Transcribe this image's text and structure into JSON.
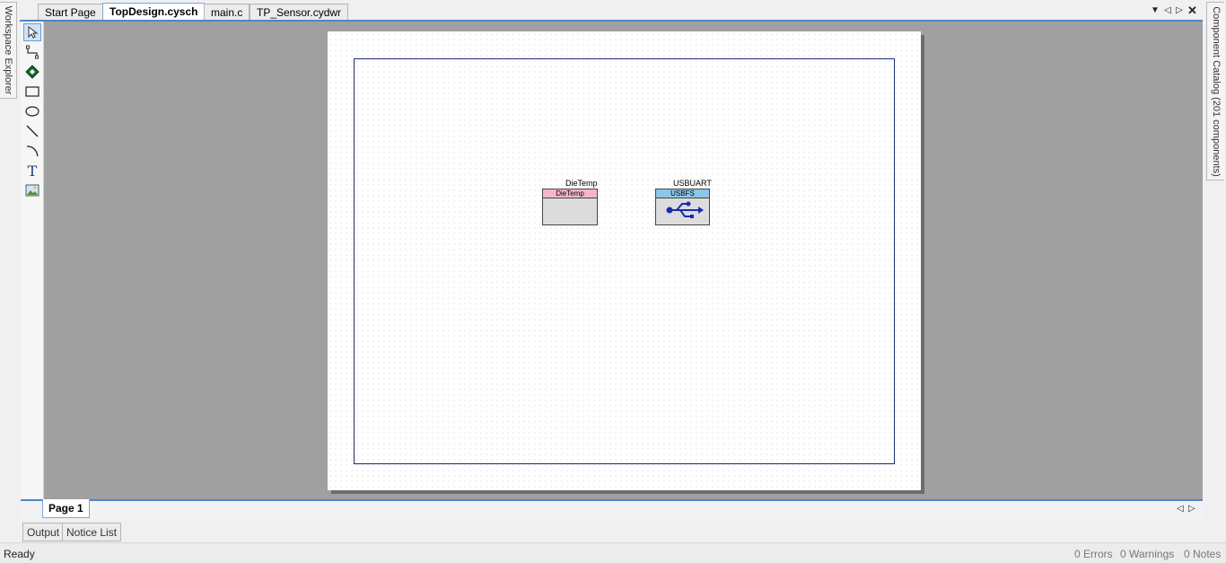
{
  "side_panels": {
    "left_label": "Workspace Explorer",
    "right_label": "Component Catalog (201 components)"
  },
  "doc_tabs": [
    {
      "label": "Start Page"
    },
    {
      "label": "TopDesign.cysch"
    },
    {
      "label": "main.c"
    },
    {
      "label": "TP_Sensor.cydwr"
    }
  ],
  "toolbox": {
    "tools": [
      "select-pointer-icon",
      "wire-icon",
      "component-icon",
      "rectangle-icon",
      "ellipse-icon",
      "line-icon",
      "arc-icon",
      "text-icon",
      "image-icon"
    ]
  },
  "schematic": {
    "components": [
      {
        "instance": "DieTemp",
        "type": "DieTemp",
        "header_color": "#f7b6c8"
      },
      {
        "instance": "USBUART",
        "type": "USBFS",
        "header_color": "#8cc7ea"
      }
    ]
  },
  "page_tabs": [
    {
      "label": "Page 1"
    }
  ],
  "bottom_tabs": [
    {
      "label": "Output"
    },
    {
      "label": "Notice List"
    }
  ],
  "status": {
    "text": "Ready",
    "errors": "0 Errors",
    "warnings": "0 Warnings",
    "notes": "0 Notes"
  },
  "colors": {
    "accent": "#4f86c6",
    "canvas_bg": "#a0a0a0",
    "frame": "#1f2a6b",
    "usb_icon": "#1a2bb0"
  }
}
